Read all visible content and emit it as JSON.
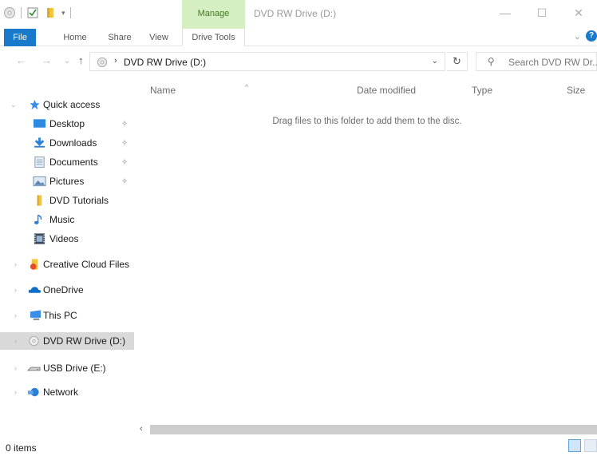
{
  "window": {
    "title": "DVD RW Drive (D:)",
    "contextual_tab": "Manage",
    "minimize": "—",
    "maximize": "☐",
    "close": "✕"
  },
  "ribbon": {
    "tabs": [
      "File",
      "Home",
      "Share",
      "View",
      "Drive Tools"
    ],
    "expand": "⌄",
    "help": "?"
  },
  "address": {
    "back": "←",
    "forward": "→",
    "recent": "⌄",
    "up": "↑",
    "separator": "›",
    "path": "DVD RW Drive (D:)",
    "dropdown": "⌄",
    "refresh": "↻"
  },
  "search": {
    "placeholder": "Search DVD RW Dr..."
  },
  "nav": {
    "quick_access": {
      "label": "Quick access",
      "expander": "⌄"
    },
    "pinned": [
      {
        "label": "Desktop",
        "icon": "desktop-icon",
        "pin": "✧"
      },
      {
        "label": "Downloads",
        "icon": "downloads-icon",
        "pin": "✧"
      },
      {
        "label": "Documents",
        "icon": "documents-icon",
        "pin": "✧"
      },
      {
        "label": "Pictures",
        "icon": "pictures-icon",
        "pin": "✧"
      },
      {
        "label": "DVD Tutorials",
        "icon": "folder-icon"
      },
      {
        "label": "Music",
        "icon": "music-icon"
      },
      {
        "label": "Videos",
        "icon": "videos-icon"
      }
    ],
    "roots": [
      {
        "label": "Creative Cloud Files",
        "icon": "creative-cloud-icon",
        "expander": "›"
      },
      {
        "label": "OneDrive",
        "icon": "onedrive-icon",
        "expander": "›"
      },
      {
        "label": "This PC",
        "icon": "this-pc-icon",
        "expander": "›"
      },
      {
        "label": "DVD RW Drive (D:)",
        "icon": "dvd-drive-icon",
        "expander": "›",
        "selected": true
      },
      {
        "label": "USB Drive (E:)",
        "icon": "usb-drive-icon",
        "expander": "›"
      },
      {
        "label": "Network",
        "icon": "network-icon",
        "expander": "›"
      }
    ]
  },
  "columns": [
    "Name",
    "Date modified",
    "Type",
    "Size"
  ],
  "sort_indicator": "^",
  "empty_message": "Drag files to this folder to add them to the disc.",
  "scroll_left": "‹",
  "status": {
    "items": "0 items"
  },
  "colors": {
    "file_tab": "#1979ca",
    "manage_tab": "#d6efc2",
    "selected_nav": "#d9d9d9"
  }
}
